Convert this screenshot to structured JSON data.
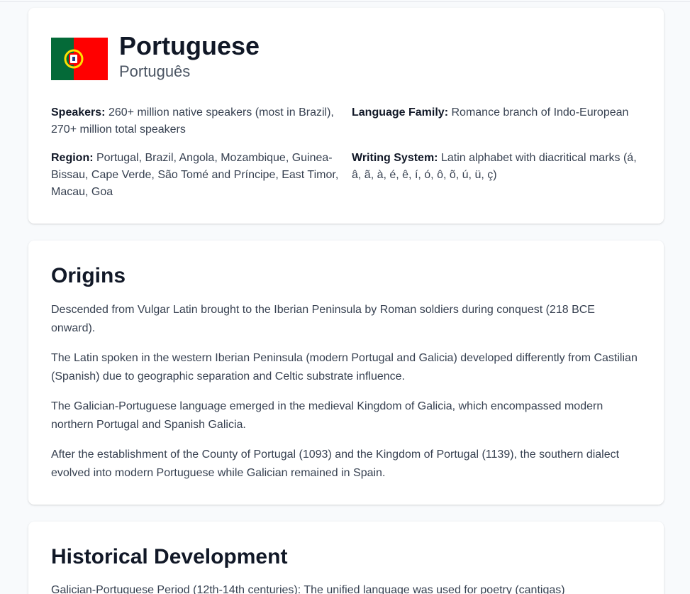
{
  "header": {
    "language_name": "Portuguese",
    "native_name": "Português",
    "flag_icon": "portugal-flag-icon",
    "flag_colors": {
      "green": "#046a38",
      "red": "#ff0000",
      "yellow": "#ffe000"
    },
    "facts": {
      "speakers": {
        "label": "Speakers:",
        "value": "260+ million native speakers (most in Brazil), 270+ million total speakers"
      },
      "family": {
        "label": "Language Family:",
        "value": "Romance branch of Indo-European"
      },
      "region": {
        "label": "Region:",
        "value": "Portugal, Brazil, Angola, Mozambique, Guinea-Bissau, Cape Verde, São Tomé and Príncipe, East Timor, Macau, Goa"
      },
      "writing": {
        "label": "Writing System:",
        "value": "Latin alphabet with diacritical marks (á, â, ã, à, é, ê, í, ó, ô, õ, ú, ü, ç)"
      }
    }
  },
  "origins": {
    "title": "Origins",
    "paragraphs": [
      "Descended from Vulgar Latin brought to the Iberian Peninsula by Roman soldiers during conquest (218 BCE onward).",
      "The Latin spoken in the western Iberian Peninsula (modern Portugal and Galicia) developed differently from Castilian (Spanish) due to geographic separation and Celtic substrate influence.",
      "The Galician-Portuguese language emerged in the medieval Kingdom of Galicia, which encompassed modern northern Portugal and Spanish Galicia.",
      "After the establishment of the County of Portugal (1093) and the Kingdom of Portugal (1139), the southern dialect evolved into modern Portuguese while Galician remained in Spain."
    ]
  },
  "history": {
    "title": "Historical Development",
    "first_paragraph": "Galician-Portuguese Period (12th-14th centuries): The unified language was used for poetry (cantigas)"
  }
}
